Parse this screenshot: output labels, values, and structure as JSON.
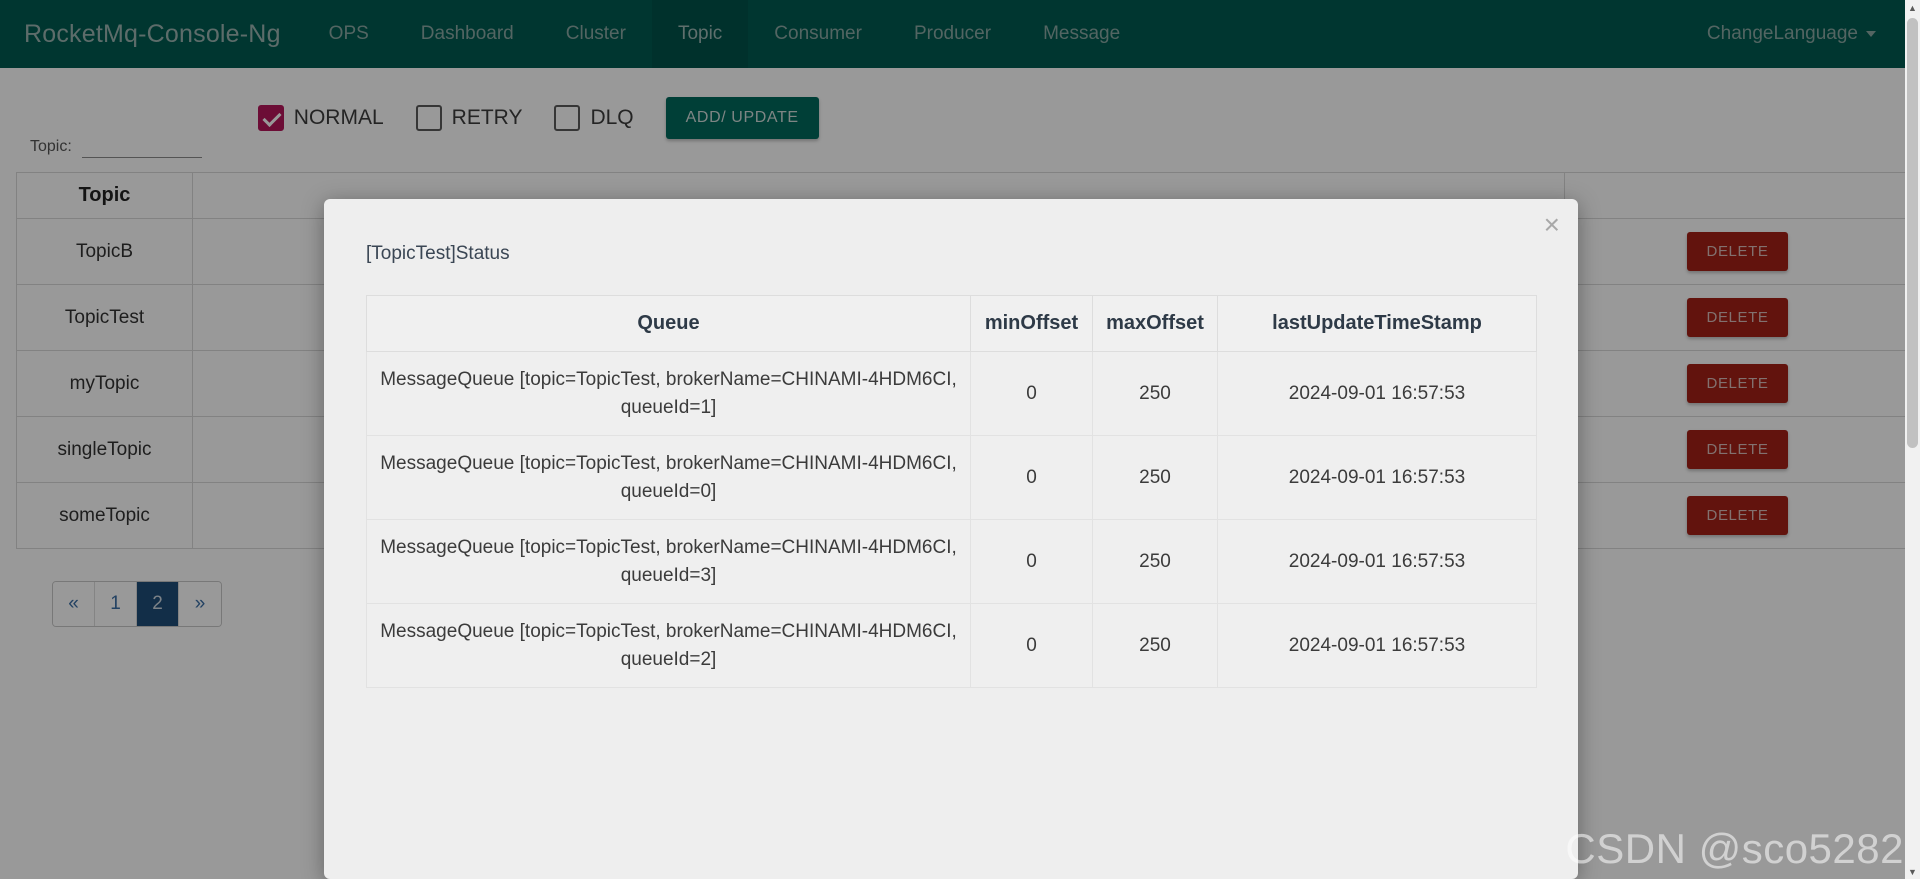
{
  "navbar": {
    "brand": "RocketMq-Console-Ng",
    "items": [
      {
        "label": "OPS",
        "active": false
      },
      {
        "label": "Dashboard",
        "active": false
      },
      {
        "label": "Cluster",
        "active": false
      },
      {
        "label": "Topic",
        "active": true
      },
      {
        "label": "Consumer",
        "active": false
      },
      {
        "label": "Producer",
        "active": false
      },
      {
        "label": "Message",
        "active": false
      }
    ],
    "change_language": "ChangeLanguage",
    "accent_color": "#015B51",
    "active_tab_color": "#00534A"
  },
  "filter": {
    "topic_label": "Topic:",
    "topic_value": "",
    "topic_placeholder": "",
    "checkboxes": [
      {
        "label": "NORMAL",
        "checked": true
      },
      {
        "label": "RETRY",
        "checked": false
      },
      {
        "label": "DLQ",
        "checked": false
      }
    ],
    "add_update_button": "ADD/ UPDATE",
    "checked_color": "#b5175a",
    "button_color": "#00695C"
  },
  "topic_table": {
    "headers": [
      "Topic",
      "",
      ""
    ],
    "rows": [
      {
        "topic": "TopicB",
        "col2": "",
        "action": "DELETE"
      },
      {
        "topic": "TopicTest",
        "col2": "",
        "action": "DELETE"
      },
      {
        "topic": "myTopic",
        "col2": "",
        "action": "DELETE"
      },
      {
        "topic": "singleTopic",
        "col2": "",
        "action": "DELETE"
      },
      {
        "topic": "someTopic",
        "col2": "",
        "action": "DELETE"
      }
    ],
    "delete_color": "#a32116"
  },
  "pagination": {
    "prev": "«",
    "next": "»",
    "pages": [
      "1",
      "2"
    ],
    "current": "2",
    "active_color": "#1f4e79"
  },
  "modal": {
    "title": "[TopicTest]Status",
    "close_icon": "×",
    "table": {
      "headers": [
        "Queue",
        "minOffset",
        "maxOffset",
        "lastUpdateTimeStamp"
      ],
      "rows": [
        {
          "queue": "MessageQueue [topic=TopicTest, brokerName=CHINAMI-4HDM6CI, queueId=1]",
          "minOffset": "0",
          "maxOffset": "250",
          "lastUpdateTimeStamp": "2024-09-01 16:57:53"
        },
        {
          "queue": "MessageQueue [topic=TopicTest, brokerName=CHINAMI-4HDM6CI, queueId=0]",
          "minOffset": "0",
          "maxOffset": "250",
          "lastUpdateTimeStamp": "2024-09-01 16:57:53"
        },
        {
          "queue": "MessageQueue [topic=TopicTest, brokerName=CHINAMI-4HDM6CI, queueId=3]",
          "minOffset": "0",
          "maxOffset": "250",
          "lastUpdateTimeStamp": "2024-09-01 16:57:53"
        },
        {
          "queue": "MessageQueue [topic=TopicTest, brokerName=CHINAMI-4HDM6CI, queueId=2]",
          "minOffset": "0",
          "maxOffset": "250",
          "lastUpdateTimeStamp": "2024-09-01 16:57:53"
        }
      ]
    }
  },
  "watermark": "CSDN @sco5282",
  "scrollbar": {
    "up_arrow": "▲",
    "down_arrow": "▼"
  }
}
